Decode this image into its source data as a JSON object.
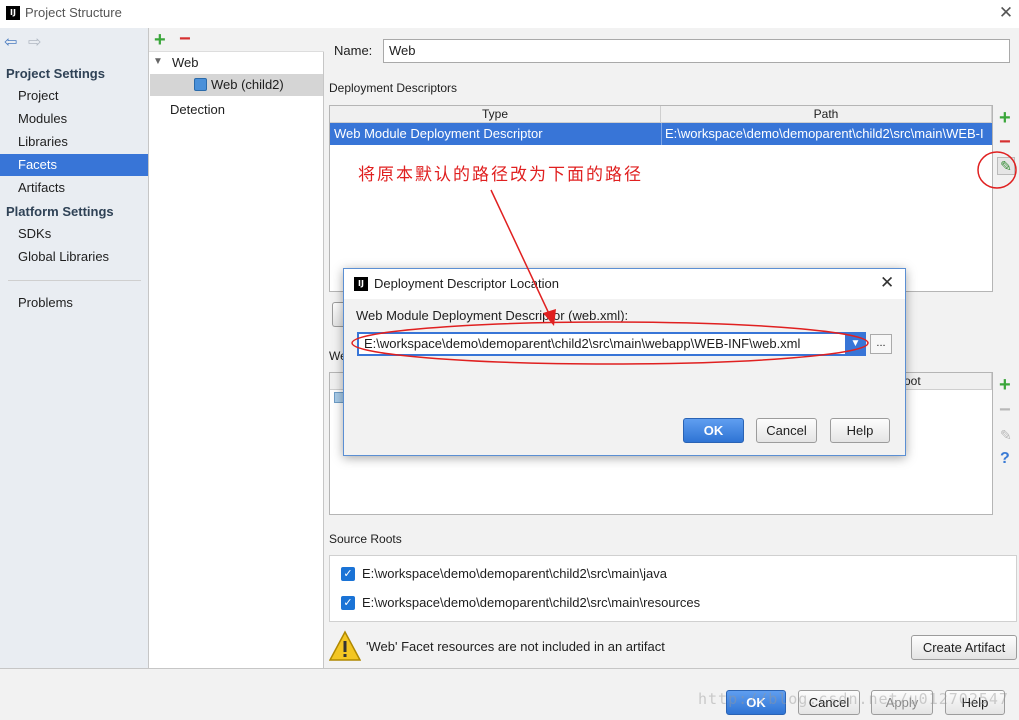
{
  "window": {
    "title": "Project Structure",
    "app_icon": "IJ"
  },
  "nav": {
    "back_icon": "arrow-left-icon",
    "forward_icon": "arrow-right-icon",
    "project_settings_header": "Project Settings",
    "project_settings": [
      "Project",
      "Modules",
      "Libraries",
      "Facets",
      "Artifacts"
    ],
    "platform_settings_header": "Platform Settings",
    "platform_settings": [
      "SDKs",
      "Global Libraries"
    ],
    "problems": "Problems",
    "selected": "Facets"
  },
  "tree": {
    "root": "Web",
    "child": "Web (child2)",
    "detection": "Detection"
  },
  "facet": {
    "name_label": "Name:",
    "name_value": "Web",
    "deployment_descriptors_label": "Deployment Descriptors",
    "columns": [
      "Type",
      "Path"
    ],
    "rows": [
      {
        "type": "Web Module Deployment Descriptor",
        "path": "E:\\workspace\\demo\\demoparent\\child2\\src\\main\\WEB-I"
      }
    ],
    "web_resource_label_fragment": "We",
    "web_resource_root_fragment": "oot",
    "source_roots_label": "Source Roots",
    "source_roots": [
      "E:\\workspace\\demo\\demoparent\\child2\\src\\main\\java",
      "E:\\workspace\\demo\\demoparent\\child2\\src\\main\\resources"
    ],
    "warning_text": "'Web' Facet resources are not included in an artifact",
    "create_artifact": "Create Artifact"
  },
  "dialog": {
    "title": "Deployment Descriptor Location",
    "label": "Web Module Deployment Descriptor (web.xml):",
    "value": "E:\\workspace\\demo\\demoparent\\child2\\src\\main\\webapp\\WEB-INF\\web.xml",
    "browse": "...",
    "ok": "OK",
    "cancel": "Cancel",
    "help": "Help"
  },
  "footer": {
    "ok": "OK",
    "cancel": "Cancel",
    "apply": "Apply",
    "help": "Help"
  },
  "annotation": {
    "text": "将原本默认的路径改为下面的路径"
  },
  "watermark": "http://blog.csdn.net/u012702547",
  "colors": {
    "selection": "#3875d7",
    "annotation_red": "#e02020",
    "add_green": "#3aa63a",
    "remove_red": "#d63030"
  }
}
